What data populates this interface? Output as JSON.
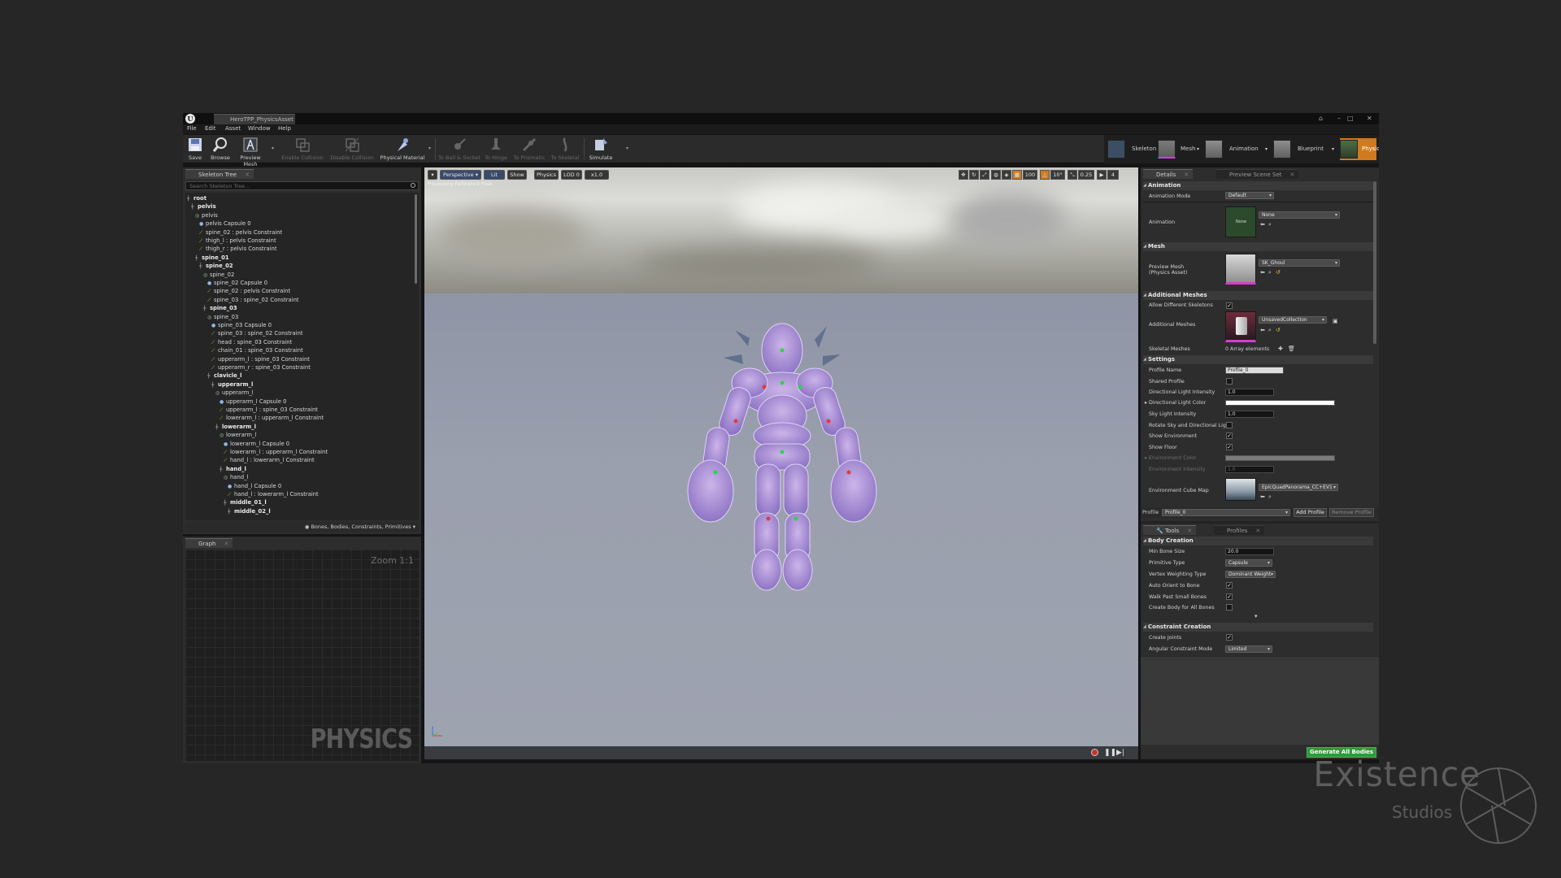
{
  "window": {
    "doc_tab_title": "HeroTPP_PhysicsAsset",
    "controls": [
      "–",
      "□",
      "✕"
    ]
  },
  "menu": [
    "File",
    "Edit",
    "Asset",
    "Window",
    "Help"
  ],
  "toolbar": {
    "save": "Save",
    "browse": "Browse",
    "preview_mesh": "Preview Mesh",
    "enable_collision": "Enable Collision",
    "disable_collision": "Disable Collision",
    "physical_material": "Physical Material",
    "to_ball_socket": "To Ball & Socket",
    "to_hinge": "To Hinge",
    "to_prismatic": "To Prismatic",
    "to_skeletal": "To Skeletal",
    "simulate": "Simulate"
  },
  "modes": {
    "skeleton": "Skeleton",
    "mesh": "Mesh",
    "animation": "Animation",
    "blueprint": "Blueprint",
    "physics": "Physics"
  },
  "skeleton_tree": {
    "tab": "Skeleton Tree",
    "search_placeholder": "Search Skeleton Tree...",
    "filter_label": "Bones, Bodies, Constraints, Primitives",
    "rows": [
      {
        "indent": 0,
        "kind": "bone",
        "text": "root"
      },
      {
        "indent": 1,
        "kind": "bone",
        "text": "pelvis"
      },
      {
        "indent": 2,
        "kind": "body",
        "text": "pelvis"
      },
      {
        "indent": 3,
        "kind": "shape",
        "text": "pelvis Capsule 0"
      },
      {
        "indent": 3,
        "kind": "con",
        "text": "spine_02 : pelvis Constraint"
      },
      {
        "indent": 3,
        "kind": "con",
        "text": "thigh_l : pelvis Constraint"
      },
      {
        "indent": 3,
        "kind": "con",
        "text": "thigh_r : pelvis Constraint"
      },
      {
        "indent": 2,
        "kind": "bone",
        "text": "spine_01"
      },
      {
        "indent": 3,
        "kind": "bone",
        "text": "spine_02"
      },
      {
        "indent": 4,
        "kind": "body",
        "text": "spine_02"
      },
      {
        "indent": 5,
        "kind": "shape",
        "text": "spine_02 Capsule 0"
      },
      {
        "indent": 5,
        "kind": "con",
        "text": "spine_02 : pelvis Constraint"
      },
      {
        "indent": 5,
        "kind": "con",
        "text": "spine_03 : spine_02 Constraint"
      },
      {
        "indent": 4,
        "kind": "bone",
        "text": "spine_03"
      },
      {
        "indent": 5,
        "kind": "body",
        "text": "spine_03"
      },
      {
        "indent": 6,
        "kind": "shape",
        "text": "spine_03 Capsule 0"
      },
      {
        "indent": 6,
        "kind": "con",
        "text": "spine_03 : spine_02 Constraint"
      },
      {
        "indent": 6,
        "kind": "con",
        "text": "head : spine_03 Constraint"
      },
      {
        "indent": 6,
        "kind": "con",
        "text": "chain_01 : spine_03 Constraint"
      },
      {
        "indent": 6,
        "kind": "con",
        "text": "upperarm_l : spine_03 Constraint"
      },
      {
        "indent": 6,
        "kind": "con",
        "text": "upperarm_r : spine_03 Constraint"
      },
      {
        "indent": 5,
        "kind": "bone",
        "text": "clavicle_l"
      },
      {
        "indent": 6,
        "kind": "bone",
        "text": "upperarm_l"
      },
      {
        "indent": 7,
        "kind": "body",
        "text": "upperarm_l"
      },
      {
        "indent": 8,
        "kind": "shape",
        "text": "upperarm_l Capsule 0"
      },
      {
        "indent": 8,
        "kind": "con",
        "text": "upperarm_l : spine_03 Constraint"
      },
      {
        "indent": 8,
        "kind": "con",
        "text": "lowerarm_l : upperarm_l Constraint"
      },
      {
        "indent": 7,
        "kind": "bone",
        "text": "lowerarm_l"
      },
      {
        "indent": 8,
        "kind": "body",
        "text": "lowerarm_l"
      },
      {
        "indent": 9,
        "kind": "shape",
        "text": "lowerarm_l Capsule 0"
      },
      {
        "indent": 9,
        "kind": "con",
        "text": "lowerarm_l : upperarm_l Constraint"
      },
      {
        "indent": 9,
        "kind": "con",
        "text": "hand_l : lowerarm_l Constraint"
      },
      {
        "indent": 8,
        "kind": "bone",
        "text": "hand_l"
      },
      {
        "indent": 9,
        "kind": "body",
        "text": "hand_l"
      },
      {
        "indent": 10,
        "kind": "shape",
        "text": "hand_l Capsule 0"
      },
      {
        "indent": 10,
        "kind": "con",
        "text": "hand_l : lowerarm_l Constraint"
      },
      {
        "indent": 9,
        "kind": "bone",
        "text": "middle_01_l"
      },
      {
        "indent": 10,
        "kind": "bone",
        "text": "middle_02_l"
      }
    ]
  },
  "graph": {
    "tab": "Graph",
    "zoom": "Zoom 1:1",
    "watermark": "PHYSICS"
  },
  "viewport": {
    "perspective": "Perspective",
    "lit": "Lit",
    "show": "Show",
    "physics": "Physics",
    "lod": "LOD 0",
    "speed": "x1.0",
    "overlay_text": "Previewing Reference Pose",
    "right_values": [
      "100",
      "10°",
      "0.25",
      "4"
    ]
  },
  "details": {
    "tab_details": "Details",
    "tab_preview": "Preview Scene Set",
    "animation": {
      "title": "Animation",
      "mode_label": "Animation Mode",
      "mode_value": "Default",
      "anim_label": "Animation",
      "anim_value": "None",
      "thumb_text": "None"
    },
    "mesh": {
      "title": "Mesh",
      "preview_label": "Preview Mesh",
      "preview_sub": "(Physics Asset)",
      "preview_value": "SK_Ghoul"
    },
    "additional": {
      "title": "Additional Meshes",
      "allow_label": "Allow Different Skeletons",
      "meshes_label": "Additional Meshes",
      "meshes_value": "UnsavedCollection",
      "skeletal_label": "Skeletal Meshes",
      "skeletal_value": "0 Array elements"
    },
    "settings": {
      "title": "Settings",
      "profile_name_label": "Profile Name",
      "profile_name_value": "Profile_0",
      "shared_profile": "Shared Profile",
      "dir_intensity_label": "Directional Light Intensity",
      "dir_intensity_value": "1.0",
      "dir_color_label": "Directional Light Color",
      "sky_intensity_label": "Sky Light Intensity",
      "sky_intensity_value": "1.0",
      "rotate_sky_label": "Rotate Sky and Directional Lig",
      "show_env_label": "Show Environment",
      "show_floor_label": "Show Floor",
      "env_color_label": "Environment Color",
      "env_intensity_label": "Environment Intensity",
      "env_intensity_value": "1.0",
      "cube_map_label": "Environment Cube Map",
      "cube_map_value": "EpicQuadPanorama_CC+EV1"
    },
    "profile_bar": {
      "label": "Profile",
      "value": "Profile_0",
      "add": "Add Profile",
      "remove": "Remove Profile"
    }
  },
  "tools": {
    "tab_tools": "Tools",
    "tab_profiles": "Profiles",
    "body_creation": {
      "title": "Body Creation",
      "min_bone_label": "Min Bone Size",
      "min_bone_value": "20.0",
      "primitive_label": "Primitive Type",
      "primitive_value": "Capsule",
      "vertex_label": "Vertex Weighting Type",
      "vertex_value": "Dominant Weight",
      "auto_orient_label": "Auto Orient to Bone",
      "walk_past_label": "Walk Past Small Bones",
      "create_body_label": "Create Body for All Bones"
    },
    "constraint_creation": {
      "title": "Constraint Creation",
      "create_joints_label": "Create Joints",
      "angular_label": "Angular Constraint Mode",
      "angular_value": "Limited"
    },
    "generate": "Generate All Bodies"
  },
  "branding": {
    "name": "Existence",
    "sub": "Studios"
  }
}
